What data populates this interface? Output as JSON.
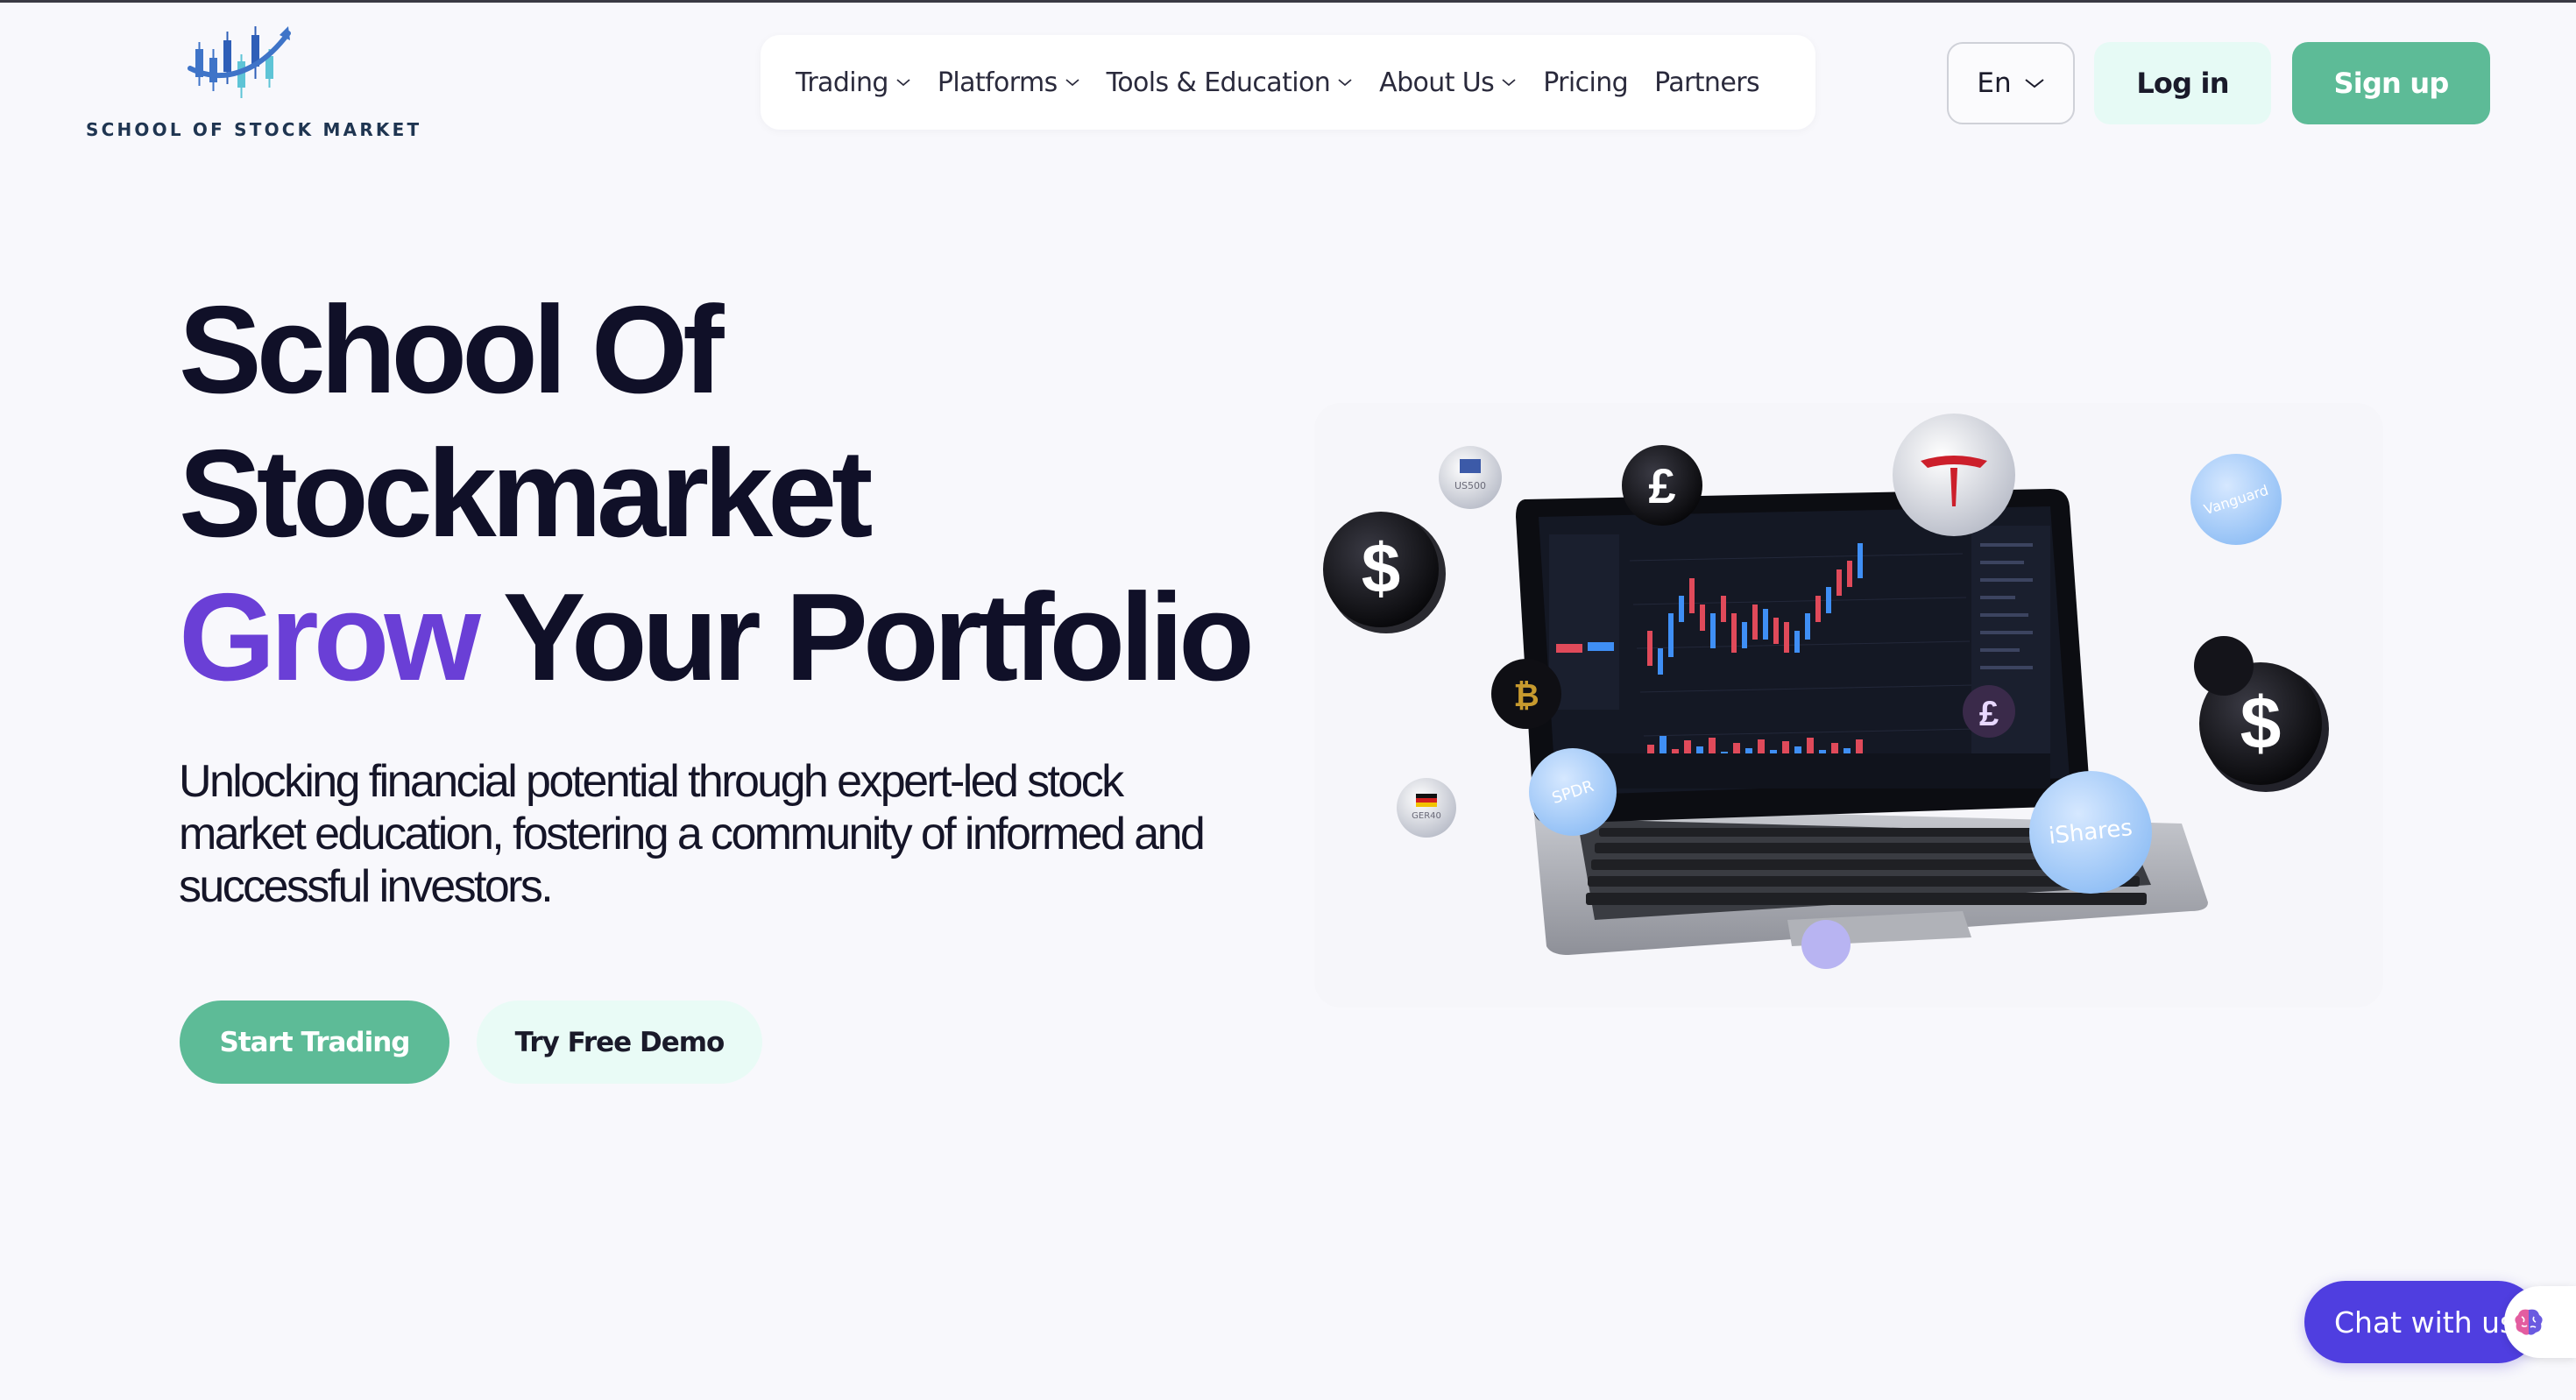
{
  "brand": {
    "name": "SCHOOL OF STOCK MARKET",
    "logo_icon": "candlestick-chart-logo"
  },
  "nav": {
    "items": [
      {
        "label": "Trading",
        "has_dropdown": true
      },
      {
        "label": "Platforms",
        "has_dropdown": true
      },
      {
        "label": "Tools & Education",
        "has_dropdown": true
      },
      {
        "label": "About Us",
        "has_dropdown": true
      },
      {
        "label": "Pricing",
        "has_dropdown": false
      },
      {
        "label": "Partners",
        "has_dropdown": false
      }
    ]
  },
  "header": {
    "language": "En",
    "login_label": "Log in",
    "signup_label": "Sign up"
  },
  "hero": {
    "title_line1": "School Of",
    "title_line2": "Stockmarket",
    "title_accent": "Grow",
    "title_rest": " Your Portfolio",
    "subtitle": "Unlocking financial potential through expert-led stock market education, fostering a community of informed and successful investors.",
    "start_label": "Start Trading",
    "demo_label": "Try Free Demo"
  },
  "illustration": {
    "coins": [
      "US500",
      "GER40",
      "Vanguard",
      "SPDR",
      "iShares"
    ],
    "icons": [
      "dollar-coin-icon",
      "pound-coin-icon",
      "bitcoin-coin-icon",
      "tesla-coin-icon"
    ]
  },
  "chat": {
    "label": "Chat with us",
    "icon": "brain-icon"
  },
  "colors": {
    "accent_purple": "#6a3fd6",
    "brand_green": "#5dbb97",
    "mint": "#e6faf5",
    "chat_purple": "#4f3ee0",
    "background": "#f8f8fc"
  }
}
